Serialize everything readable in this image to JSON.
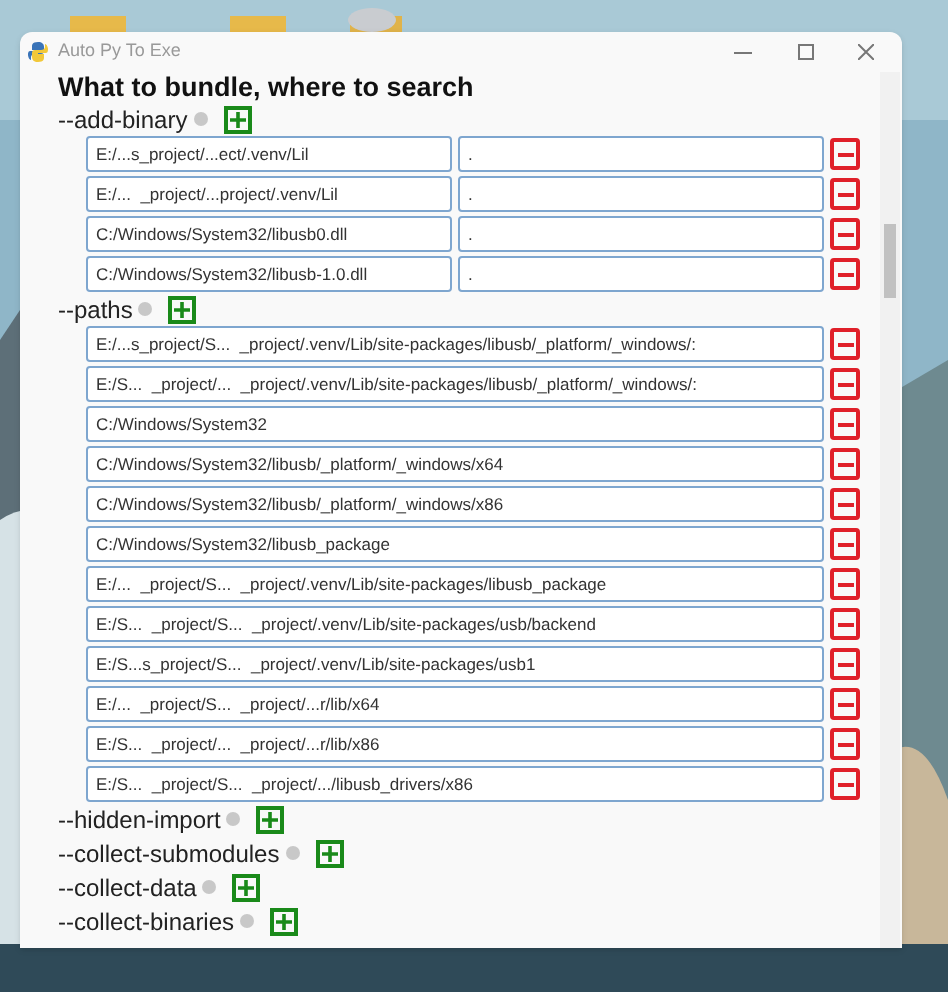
{
  "window": {
    "title": "Auto Py To Exe"
  },
  "heading": "What to bundle, where to search",
  "sections": [
    {
      "label": "--add-binary",
      "kind": "pair",
      "entries": [
        {
          "source": "E:/...s_project/...ect/.venv/Lil",
          "dest": "."
        },
        {
          "source": "E:/...  _project/...project/.venv/Lil",
          "dest": "."
        },
        {
          "source": "C:/Windows/System32/libusb0.dll",
          "dest": "."
        },
        {
          "source": "C:/Windows/System32/libusb-1.0.dll",
          "dest": "."
        }
      ]
    },
    {
      "label": "--paths",
      "kind": "single",
      "entries": [
        {
          "source": "E:/...s_project/S...  _project/.venv/Lib/site-packages/libusb/_platform/_windows/:"
        },
        {
          "source": "E:/S...  _project/...  _project/.venv/Lib/site-packages/libusb/_platform/_windows/:"
        },
        {
          "source": "C:/Windows/System32"
        },
        {
          "source": "C:/Windows/System32/libusb/_platform/_windows/x64"
        },
        {
          "source": "C:/Windows/System32/libusb/_platform/_windows/x86"
        },
        {
          "source": "C:/Windows/System32/libusb_package"
        },
        {
          "source": "E:/...  _project/S...  _project/.venv/Lib/site-packages/libusb_package"
        },
        {
          "source": "E:/S...  _project/S...  _project/.venv/Lib/site-packages/usb/backend"
        },
        {
          "source": "E:/S...s_project/S...  _project/.venv/Lib/site-packages/usb1"
        },
        {
          "source": "E:/...  _project/S...  _project/...r/lib/x64"
        },
        {
          "source": "E:/S...  _project/...  _project/...r/lib/x86"
        },
        {
          "source": "E:/S...  _project/S...  _project/.../libusb_drivers/x86"
        }
      ]
    },
    {
      "label": "--hidden-import"
    },
    {
      "label": "--collect-submodules"
    },
    {
      "label": "--collect-data"
    },
    {
      "label": "--collect-binaries"
    }
  ]
}
